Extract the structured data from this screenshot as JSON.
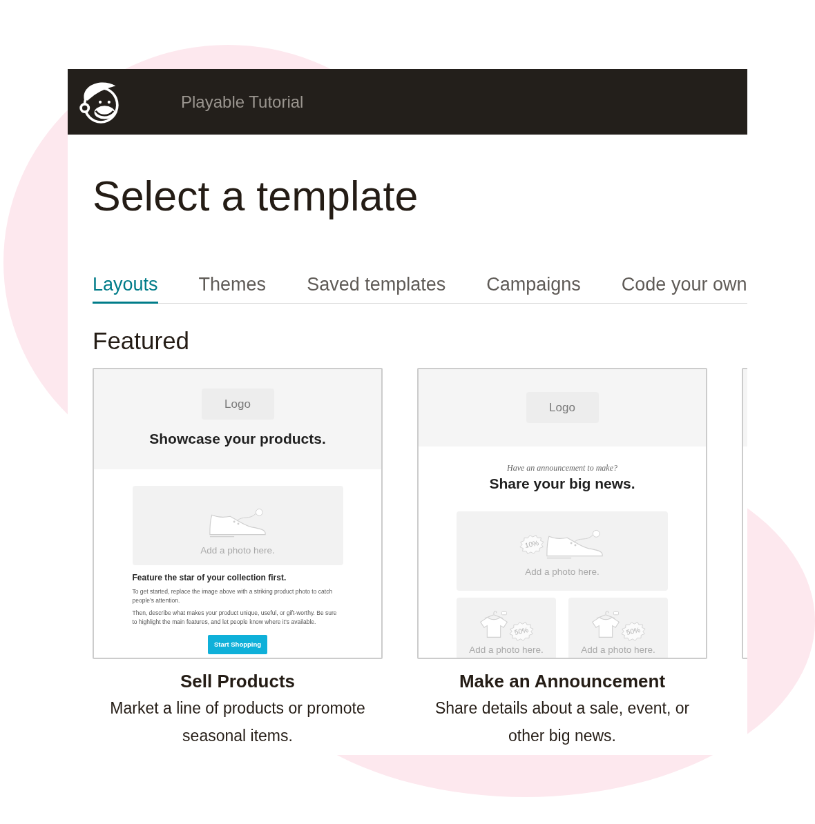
{
  "header": {
    "title": "Playable Tutorial"
  },
  "page_title": "Select a template",
  "tabs": [
    {
      "label": "Layouts",
      "selected": true
    },
    {
      "label": "Themes",
      "selected": false
    },
    {
      "label": "Saved templates",
      "selected": false
    },
    {
      "label": "Campaigns",
      "selected": false
    },
    {
      "label": "Code your own",
      "selected": false
    }
  ],
  "section_title": "Featured",
  "templates": [
    {
      "kind": "product",
      "title": "Sell Products",
      "description": "Market a line of products or promote seasonal items.",
      "preview": {
        "logo": "Logo",
        "headline": "Showcase your products.",
        "photo": {
          "caption": "Add a photo here."
        },
        "subheading": "Feature the star of your collection first.",
        "paragraphs": [
          "To get started, replace the image above with a striking product photo to catch people’s attention.",
          "Then, describe what makes your product unique, useful, or gift-worthy. Be sure to highlight the main features, and let people know where it’s available."
        ],
        "button": "Start Shopping"
      }
    },
    {
      "kind": "announcement",
      "title": "Make an Announcement",
      "description": "Share details about a sale, event, or other big news.",
      "preview": {
        "logo": "Logo",
        "kicker": "Have an announcement to make?",
        "headline": "Share your big news.",
        "photo": {
          "caption": "Add a photo here.",
          "tag": "10%"
        },
        "small_photos": [
          {
            "caption": "Add a photo here.",
            "tag": "50%"
          },
          {
            "caption": "Add a photo here.",
            "tag": "50%"
          }
        ]
      }
    },
    {
      "kind": "cut_off"
    }
  ]
}
